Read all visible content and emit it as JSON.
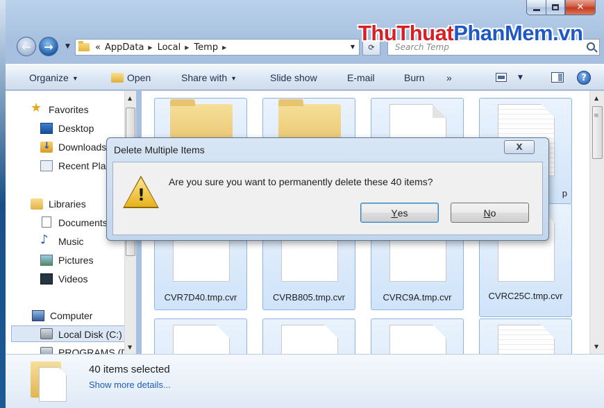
{
  "window": {
    "caption": {
      "minimize": "—",
      "maximize": "☐",
      "close": "✕"
    }
  },
  "watermark": {
    "part1": "ThuThuat",
    "part2": "PhanMem.vn"
  },
  "address": {
    "prefix": "«",
    "crumbs": [
      "AppData",
      "Local",
      "Temp"
    ],
    "refresh": "⟳"
  },
  "search": {
    "placeholder": "Search Temp"
  },
  "toolbar": {
    "organize": "Organize",
    "open": "Open",
    "share_with": "Share with",
    "slide_show": "Slide show",
    "email": "E-mail",
    "burn": "Burn",
    "more": "»",
    "help": "?"
  },
  "nav": {
    "favorites": "Favorites",
    "desktop": "Desktop",
    "downloads": "Downloads",
    "recent_places": "Recent Places",
    "libraries": "Libraries",
    "documents": "Documents",
    "music": "Music",
    "pictures": "Pictures",
    "videos": "Videos",
    "computer": "Computer",
    "local_disk": "Local Disk (C:)",
    "programs": "PROGRAMS (D:)"
  },
  "files": {
    "row2": [
      "CVR7D40.tmp.cvr",
      "CVRB805.tmp.cvr",
      "CVRC9A.tmp.cvr",
      "CVRC25C.tmp.cvr"
    ],
    "row1_partial_label": "p"
  },
  "details": {
    "count": "40 items selected",
    "more": "Show more details..."
  },
  "dialog": {
    "title": "Delete Multiple Items",
    "close": "X",
    "message": "Are you sure you want to permanently delete these 40 items?",
    "yes_mnemonic": "Y",
    "yes_rest": "es",
    "no_mnemonic": "N",
    "no_rest": "o"
  }
}
